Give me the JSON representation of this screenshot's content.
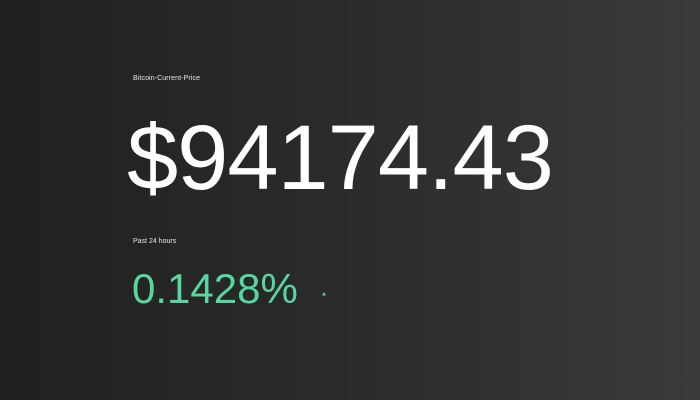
{
  "ticker": {
    "title": "Bitcoin-Current-Price",
    "price": "$94174.43",
    "period_label": "Past 24 hours",
    "change_percent": "0.1428%",
    "trend_icon": "up-arrow-icon",
    "colors": {
      "positive": "#58d6a0",
      "text": "#ffffff",
      "background_left": "#202020",
      "background_right": "#3a3a3d"
    }
  }
}
